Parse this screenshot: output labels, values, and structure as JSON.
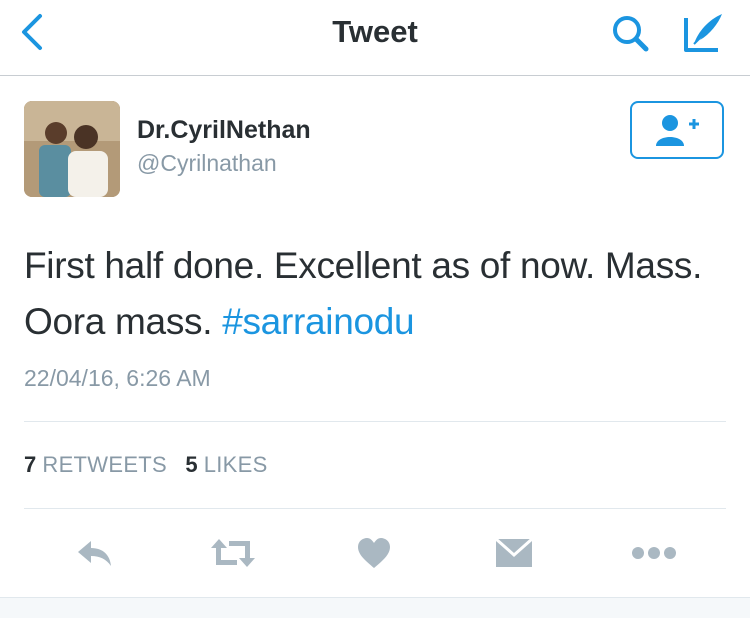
{
  "header": {
    "title": "Tweet",
    "back_icon": "chevron-left-icon",
    "search_icon": "search-icon",
    "compose_icon": "compose-tweet-icon",
    "accent": "#1b95e0"
  },
  "tweet": {
    "author": {
      "display_name": "Dr.CyrilNethan",
      "handle": "@Cyrilnathan",
      "avatar_icon": "avatar-photo"
    },
    "follow_icon": "add-user-icon",
    "text": "First half done. Excellent as of now. Mass. Oora mass. ",
    "hashtag": "#sarrainodu",
    "timestamp": "22/04/16, 6:26 AM"
  },
  "stats": {
    "retweets_count": "7",
    "retweets_label": "RETWEETS",
    "likes_count": "5",
    "likes_label": "LIKES"
  },
  "actions": [
    "reply-icon",
    "retweet-icon",
    "like-icon",
    "direct-message-icon",
    "more-icon"
  ],
  "colors": {
    "text": "#292f33",
    "muted": "#8899a6",
    "icon": "#aab8c2"
  }
}
